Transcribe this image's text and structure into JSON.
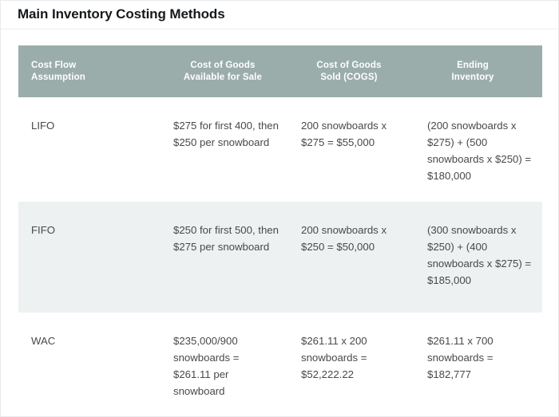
{
  "header": {
    "title": "Main Inventory Costing Methods"
  },
  "colors": {
    "table_header_bg": "#9badab",
    "table_header_text": "#ffffff",
    "row_alt_bg": "#eef1f1",
    "body_text": "#46494c",
    "title_text": "#16191c",
    "page_border": "#e9eaec"
  },
  "table": {
    "columns": [
      "Cost Flow Assumption",
      "Cost of Goods Available for Sale",
      "Cost of Goods Sold (COGS)",
      "Ending Inventory"
    ],
    "column_lines": [
      [
        "Cost Flow",
        "Assumption"
      ],
      [
        "Cost of Goods",
        "Available for Sale"
      ],
      [
        "Cost of Goods",
        "Sold (COGS)"
      ],
      [
        "Ending",
        "Inventory"
      ]
    ],
    "rows": [
      {
        "method": "LIFO",
        "cogas": "$275 for first 400, then $250 per snowboard",
        "cogs": "200 snowboards x $275 = $55,000",
        "ending_inventory": "(200 snowboards x $275) + (500 snowboards x $250) = $180,000"
      },
      {
        "method": "FIFO",
        "cogas": "$250 for first 500, then $275 per snowboard",
        "cogs": "200 snowboards x $250 = $50,000",
        "ending_inventory": "(300 snowboards x $250) + (400 snowboards x $275) = $185,000"
      },
      {
        "method": "WAC",
        "cogas": "$235,000/900 snowboards = $261.11 per snowboard",
        "cogs": "$261.11 x 200 snowboards = $52,222.22",
        "ending_inventory": "$261.11 x 700 snowboards = $182,777"
      }
    ]
  }
}
